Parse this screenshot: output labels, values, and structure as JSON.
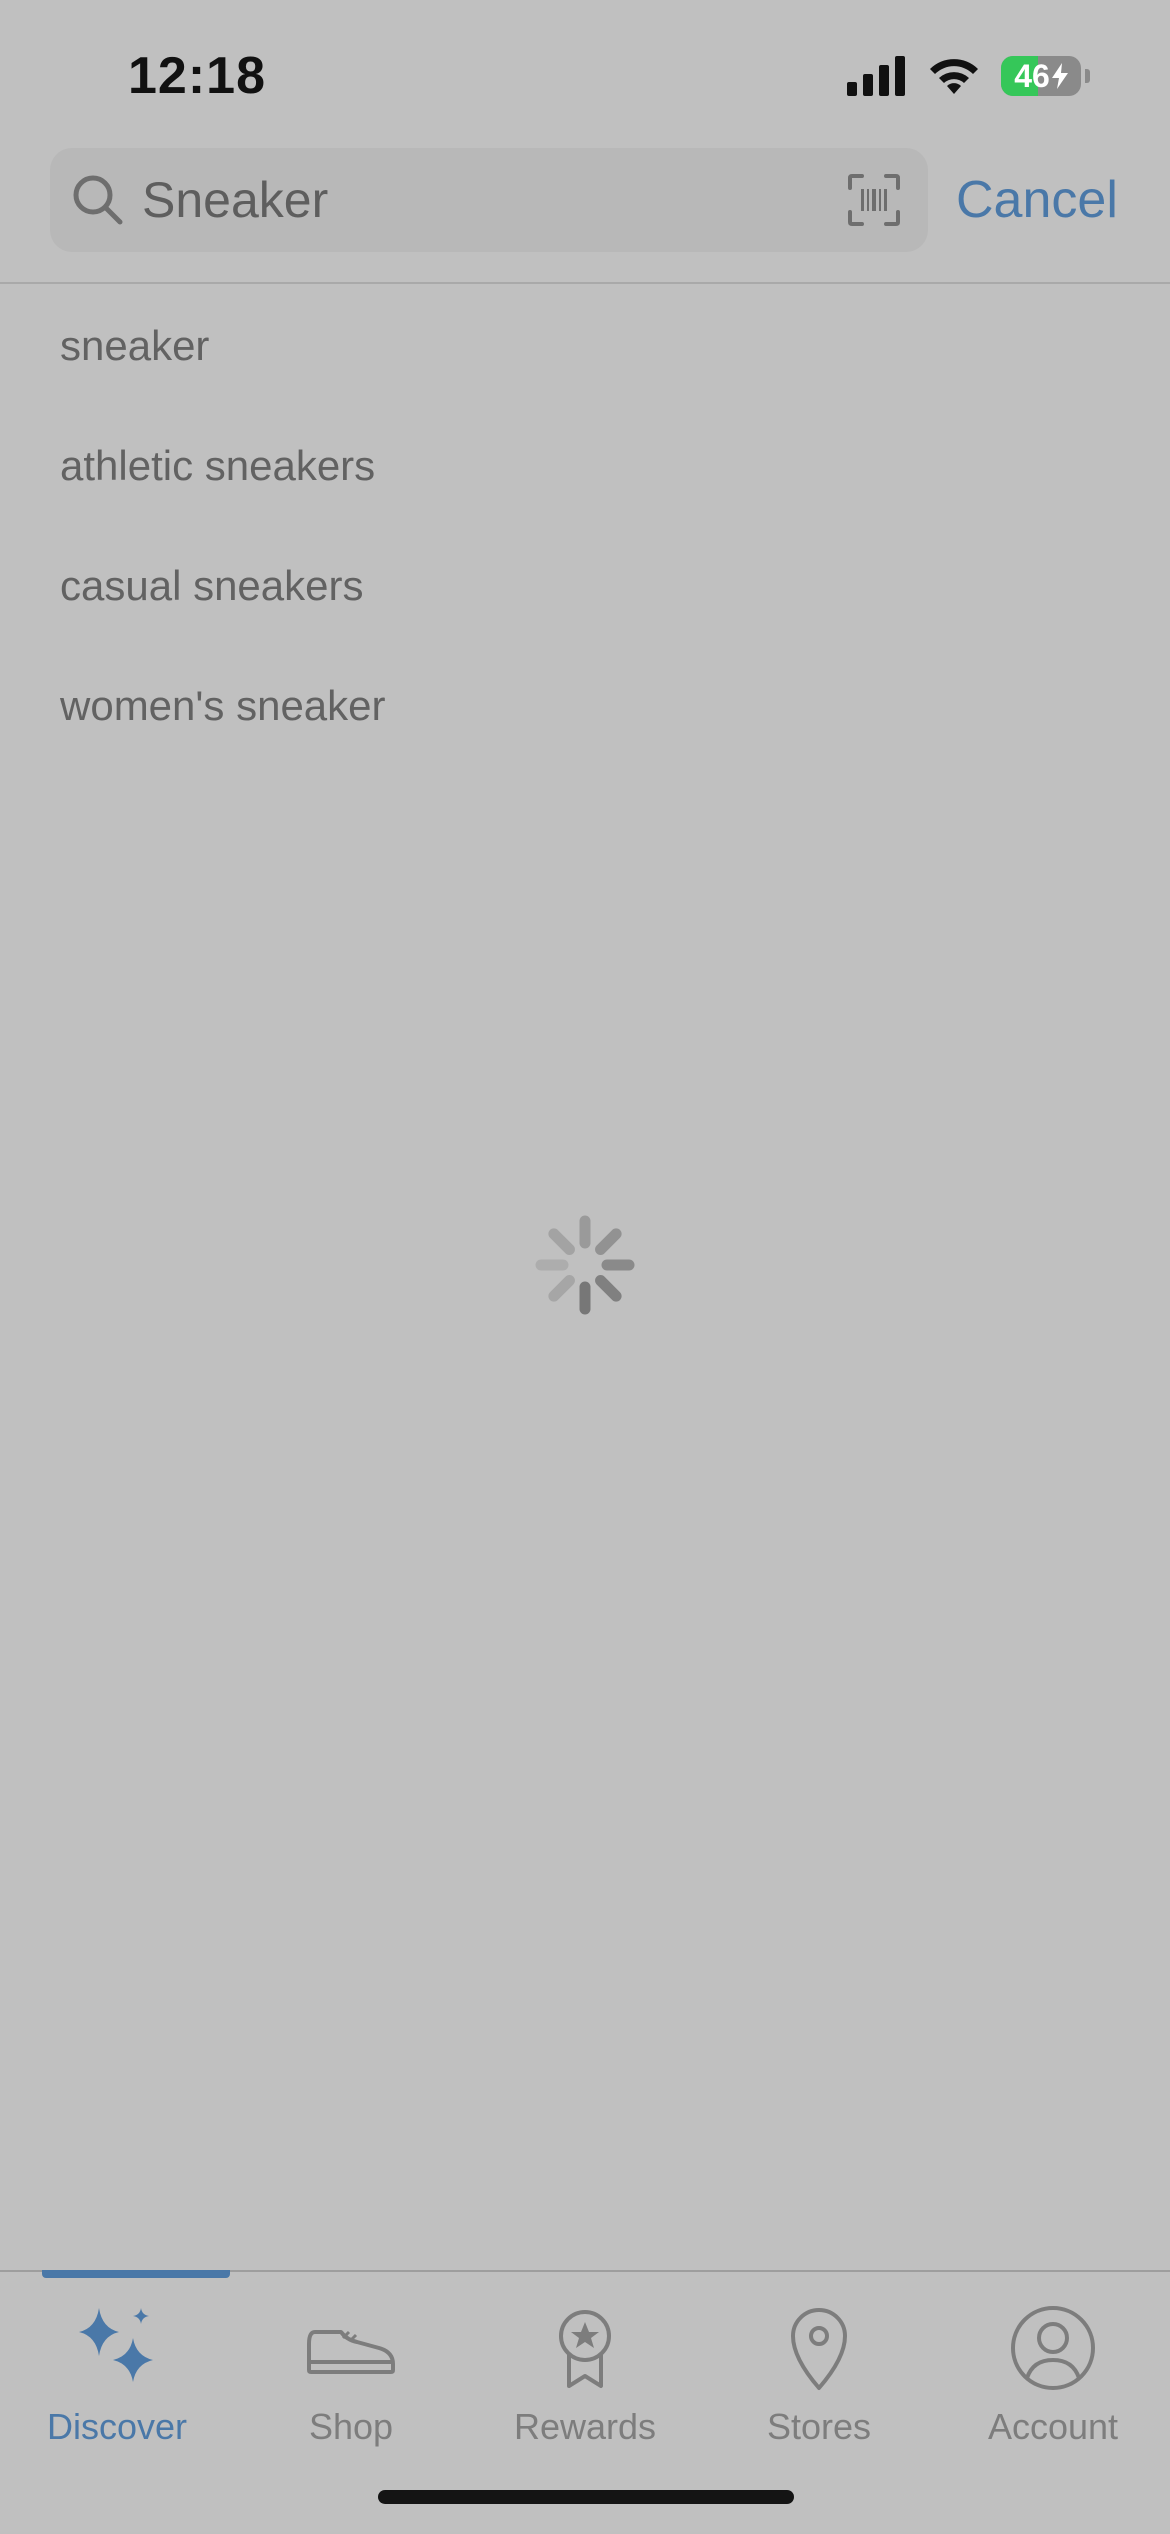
{
  "status_bar": {
    "time": "12:18",
    "battery_level": "46",
    "battery_charging": true
  },
  "search": {
    "value": "Sneaker",
    "placeholder": "",
    "cancel_label": "Cancel"
  },
  "suggestions": [
    "sneaker",
    "athletic sneakers",
    "casual sneakers",
    "women's sneaker"
  ],
  "loading": true,
  "tab_bar": {
    "active": "discover",
    "items": [
      {
        "key": "discover",
        "label": "Discover",
        "icon": "sparkles-icon"
      },
      {
        "key": "shop",
        "label": "Shop",
        "icon": "sneaker-icon"
      },
      {
        "key": "rewards",
        "label": "Rewards",
        "icon": "award-ribbon-icon"
      },
      {
        "key": "stores",
        "label": "Stores",
        "icon": "location-pin-icon"
      },
      {
        "key": "account",
        "label": "Account",
        "icon": "person-circle-icon"
      }
    ]
  },
  "colors": {
    "accent": "#4a78a8",
    "background": "#c0c0c0",
    "inactive": "#7d7d7d",
    "battery_fill": "#35c759"
  }
}
